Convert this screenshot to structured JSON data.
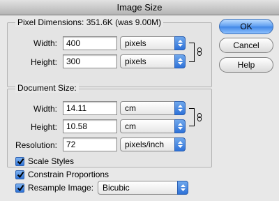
{
  "window": {
    "title": "Image Size"
  },
  "pixel_dimensions": {
    "legend": "Pixel Dimensions:",
    "size_text": "351.6K (was 9.00M)",
    "width": {
      "label": "Width:",
      "value": "400",
      "unit": "pixels"
    },
    "height": {
      "label": "Height:",
      "value": "300",
      "unit": "pixels"
    }
  },
  "document_size": {
    "legend": "Document Size:",
    "width": {
      "label": "Width:",
      "value": "14.11",
      "unit": "cm"
    },
    "height": {
      "label": "Height:",
      "value": "10.58",
      "unit": "cm"
    },
    "resolution": {
      "label": "Resolution:",
      "value": "72",
      "unit": "pixels/inch"
    }
  },
  "options": {
    "scale_styles": {
      "label": "Scale Styles",
      "checked": true
    },
    "constrain_proportions": {
      "label": "Constrain Proportions",
      "checked": true
    },
    "resample_image": {
      "label": "Resample Image:",
      "checked": true,
      "method": "Bicubic"
    }
  },
  "buttons": {
    "ok": "OK",
    "cancel": "Cancel",
    "help": "Help"
  },
  "colors": {
    "accent": "#3f86e6",
    "background": "#e8e8e8"
  }
}
